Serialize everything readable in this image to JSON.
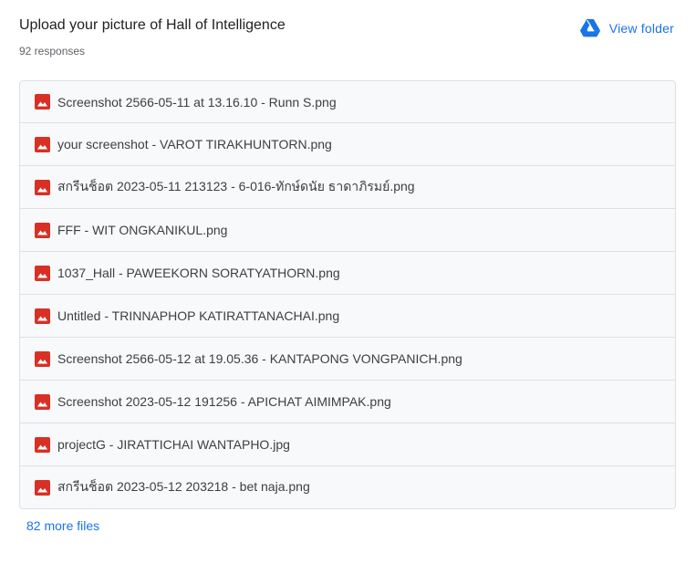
{
  "header": {
    "title": "Upload your picture of Hall of Intelligence",
    "response_count": "92 responses",
    "view_folder_label": "View folder",
    "view_folder_icon": "google-drive-icon"
  },
  "files": [
    {
      "name": "Screenshot 2566-05-11 at 13.16.10 - Runn S.png",
      "icon": "image-file-icon"
    },
    {
      "name": "your screenshot - VAROT TIRAKHUNTORN.png",
      "icon": "image-file-icon"
    },
    {
      "name": "สกรีนช็อต 2023-05-11 213123 - 6-016-ทักษ์ดนัย ธาดาภิรมย์.png",
      "icon": "image-file-icon"
    },
    {
      "name": "FFF - WIT ONGKANIKUL.png",
      "icon": "image-file-icon"
    },
    {
      "name": "1037_Hall - PAWEEKORN SORATYATHORN.png",
      "icon": "image-file-icon"
    },
    {
      "name": "Untitled - TRINNAPHOP KATIRATTANACHAI.png",
      "icon": "image-file-icon"
    },
    {
      "name": "Screenshot 2566-05-12 at 19.05.36 - KANTAPONG VONGPANICH.png",
      "icon": "image-file-icon"
    },
    {
      "name": "Screenshot 2023-05-12 191256 - APICHAT AIMIMPAK.png",
      "icon": "image-file-icon"
    },
    {
      "name": "projectG - JIRATTICHAI WANTAPHO.jpg",
      "icon": "image-file-icon"
    },
    {
      "name": "สกรีนช็อต 2023-05-12 203218 - bet naja.png",
      "icon": "image-file-icon"
    }
  ],
  "more_files_label": "82 more files",
  "colors": {
    "link": "#1a73e8",
    "image_icon": "#d93025",
    "row_background": "#f8f9fa",
    "row_border": "#e0e0e0"
  }
}
